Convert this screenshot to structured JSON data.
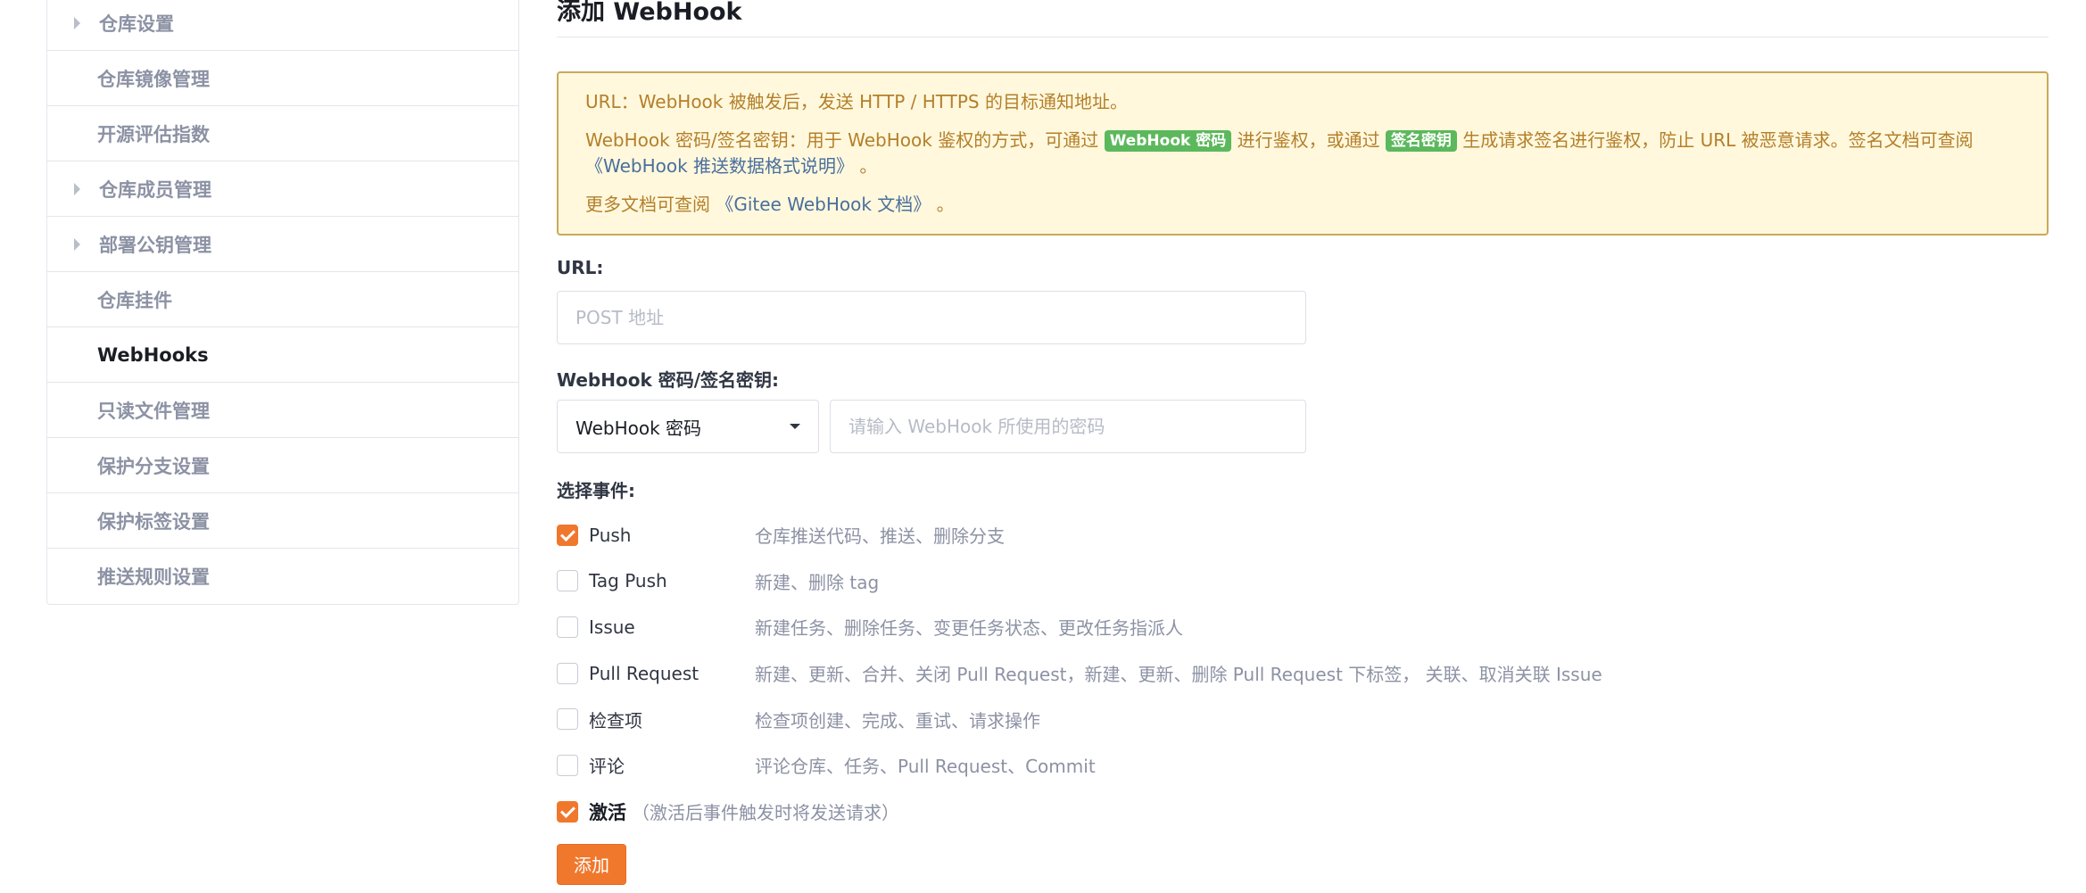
{
  "sidebar": {
    "items": [
      {
        "label": "仓库设置",
        "caret": true
      },
      {
        "label": "仓库镜像管理",
        "caret": false
      },
      {
        "label": "开源评估指数",
        "caret": false
      },
      {
        "label": "仓库成员管理",
        "caret": true
      },
      {
        "label": "部署公钥管理",
        "caret": true
      },
      {
        "label": "仓库挂件",
        "caret": false
      },
      {
        "label": "WebHooks",
        "caret": false,
        "active": true
      },
      {
        "label": "只读文件管理",
        "caret": false
      },
      {
        "label": "保护分支设置",
        "caret": false
      },
      {
        "label": "保护标签设置",
        "caret": false
      },
      {
        "label": "推送规则设置",
        "caret": false
      }
    ]
  },
  "main": {
    "title": "添加 WebHook",
    "notice": {
      "line1": "URL：WebHook 被触发后，发送 HTTP / HTTPS 的目标通知地址。",
      "line2_a": "WebHook 密码/签名密钥：用于 WebHook 鉴权的方式，可通过 ",
      "badge1": "WebHook 密码",
      "line2_b": " 进行鉴权，或通过 ",
      "badge2": "签名密钥",
      "line2_c": " 生成请求签名进行鉴权，防止 URL 被恶意请求。签名文档可查阅",
      "line2_link": "《WebHook 推送数据格式说明》",
      "line2_end": " 。",
      "line3_a": "更多文档可查阅 ",
      "line3_link": "《Gitee WebHook 文档》",
      "line3_end": " 。"
    },
    "url_label": "URL:",
    "url_placeholder": "POST 地址",
    "secret_label": "WebHook 密码/签名密钥:",
    "secret_select_value": "WebHook 密码",
    "secret_placeholder": "请输入 WebHook 所使用的密码",
    "events_label": "选择事件:",
    "events": [
      {
        "name": "Push",
        "desc": "仓库推送代码、推送、删除分支",
        "checked": true
      },
      {
        "name": "Tag Push",
        "desc": "新建、删除 tag",
        "checked": false
      },
      {
        "name": "Issue",
        "desc": "新建任务、删除任务、变更任务状态、更改任务指派人",
        "checked": false
      },
      {
        "name": "Pull Request",
        "desc": "新建、更新、合并、关闭 Pull Request，新建、更新、删除 Pull Request 下标签， 关联、取消关联 Issue",
        "checked": false
      },
      {
        "name": "检查项",
        "desc": "检查项创建、完成、重试、请求操作",
        "checked": false
      },
      {
        "name": "评论",
        "desc": "评论仓库、任务、Pull Request、Commit",
        "checked": false
      }
    ],
    "activate_label": "激活",
    "activate_hint": "（激活后事件触发时将发送请求）",
    "activate_checked": true,
    "submit_label": "添加"
  }
}
